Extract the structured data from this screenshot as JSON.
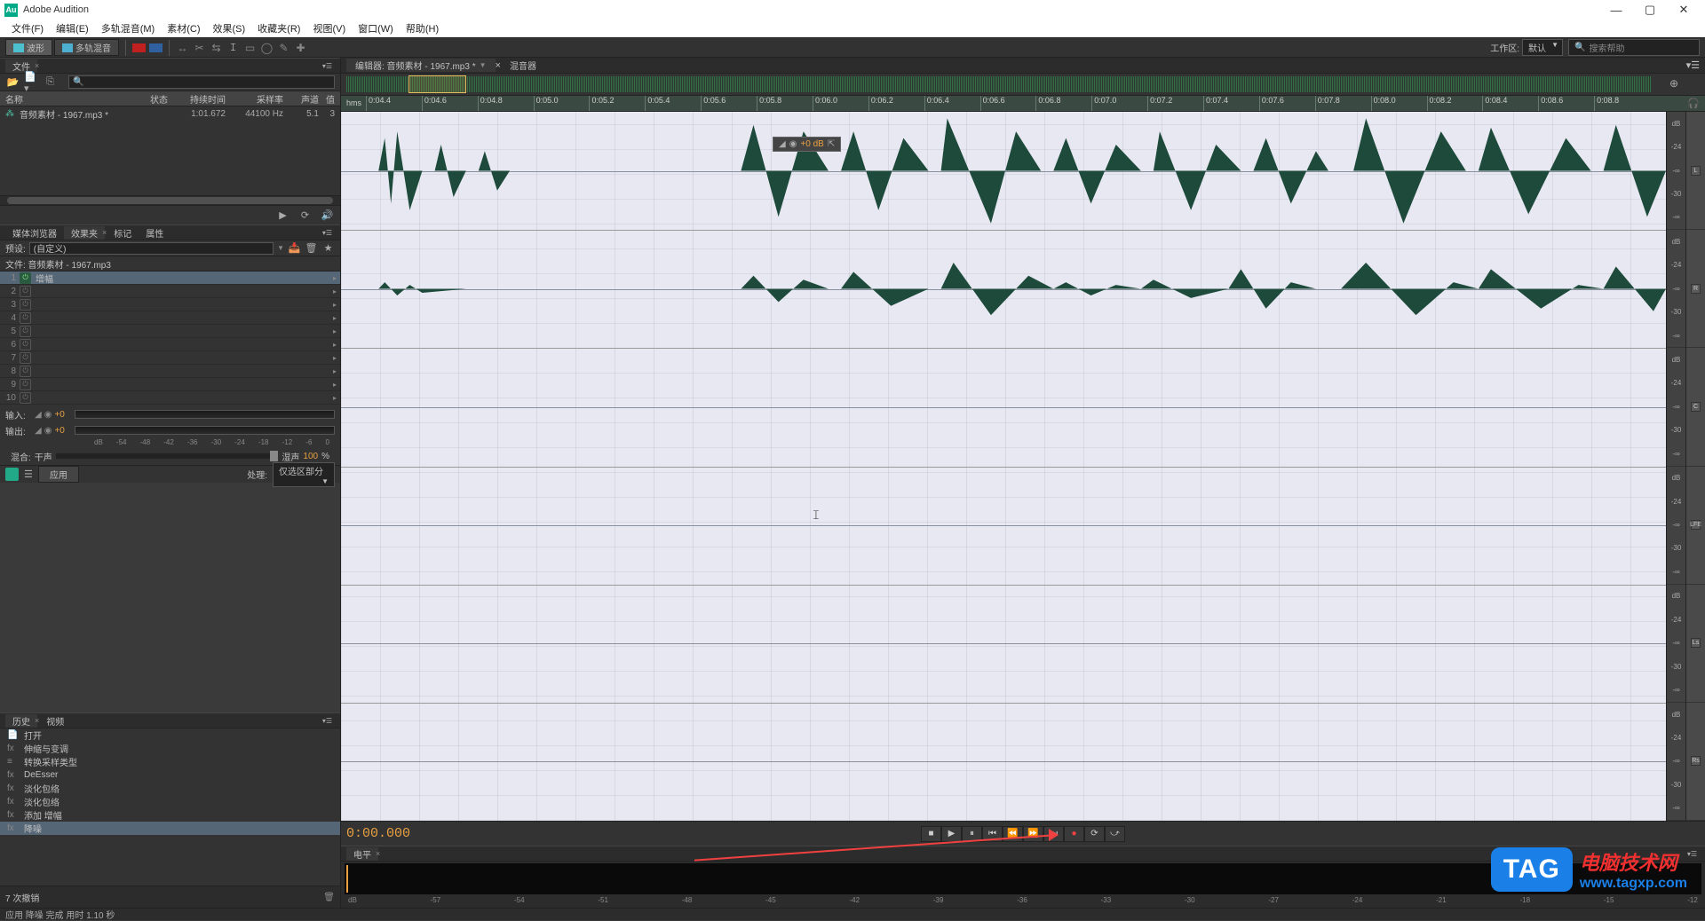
{
  "app": {
    "title": "Adobe Audition"
  },
  "menubar": [
    "文件(F)",
    "编辑(E)",
    "多轨混音(M)",
    "素材(C)",
    "效果(S)",
    "收藏夹(R)",
    "视图(V)",
    "窗口(W)",
    "帮助(H)"
  ],
  "toolbar": {
    "mode_wave": "波形",
    "mode_multi": "多轨混音",
    "workspace_label": "工作区:",
    "workspace_value": "默认",
    "search_placeholder": "搜索帮助"
  },
  "files_panel": {
    "title": "文件",
    "columns": {
      "name": "名称",
      "status": "状态",
      "duration": "持续时间",
      "rate": "采样率",
      "channels": "声道"
    },
    "items": [
      {
        "name": "音频素材 - 1967.mp3 *",
        "duration": "1:01.672",
        "rate": "44100 Hz",
        "channels": "5.1"
      }
    ],
    "ch_extra": "3"
  },
  "tabs_panel": {
    "tabs": [
      "媒体浏览器",
      "效果夹",
      "标记",
      "属性"
    ],
    "active": 1
  },
  "fx_panel": {
    "preset_label": "预设:",
    "preset_value": "(自定义)",
    "file_label": "文件: 音频素材 - 1967.mp3",
    "slots": [
      {
        "n": 1,
        "on": true,
        "name": "增幅"
      },
      {
        "n": 2,
        "on": false,
        "name": ""
      },
      {
        "n": 3,
        "on": false,
        "name": ""
      },
      {
        "n": 4,
        "on": false,
        "name": ""
      },
      {
        "n": 5,
        "on": false,
        "name": ""
      },
      {
        "n": 6,
        "on": false,
        "name": ""
      },
      {
        "n": 7,
        "on": false,
        "name": ""
      },
      {
        "n": 8,
        "on": false,
        "name": ""
      },
      {
        "n": 9,
        "on": false,
        "name": ""
      },
      {
        "n": 10,
        "on": false,
        "name": ""
      }
    ],
    "input_label": "输入:",
    "input_value": "+0",
    "output_label": "输出:",
    "output_value": "+0",
    "db_scale": [
      "dB",
      "-54",
      "-48",
      "-42",
      "-36",
      "-30",
      "-24",
      "-18",
      "-12",
      "-6",
      "0"
    ],
    "mix_label": "混合:",
    "mix_dry": "干声",
    "mix_wet": "湿声",
    "mix_pct": "100",
    "pct_sign": "%",
    "apply": "应用",
    "process_label": "处理:",
    "process_value": "仅选区部分"
  },
  "history_panel": {
    "tabs": [
      "历史",
      "视频"
    ],
    "items": [
      {
        "icon": "📄",
        "label": "打开"
      },
      {
        "icon": "fx",
        "label": "伸缩与变调"
      },
      {
        "icon": "≡",
        "label": "转换采样类型"
      },
      {
        "icon": "fx",
        "label": "DeEsser"
      },
      {
        "icon": "fx",
        "label": "淡化包络"
      },
      {
        "icon": "fx",
        "label": "淡化包络"
      },
      {
        "icon": "fx",
        "label": "添加 增幅"
      },
      {
        "icon": "fx",
        "label": "降噪"
      }
    ],
    "footer": "7 次撤销"
  },
  "editor": {
    "tab_active": "编辑器: 音频素材 - 1967.mp3 *",
    "tab_mixer": "混音器",
    "ruler_unit": "hms",
    "ruler_ticks": [
      "0:04.4",
      "0:04.6",
      "0:04.8",
      "0:05.0",
      "0:05.2",
      "0:05.4",
      "0:05.6",
      "0:05.8",
      "0:06.0",
      "0:06.2",
      "0:06.4",
      "0:06.6",
      "0:06.8",
      "0:07.0",
      "0:07.2",
      "0:07.4",
      "0:07.6",
      "0:07.8",
      "0:08.0",
      "0:08.2",
      "0:08.4",
      "0:08.6",
      "0:08.8"
    ],
    "hud_value": "+0 dB",
    "db_labels": [
      "dB",
      "-24",
      "-∞",
      "-30",
      "-∞"
    ],
    "channels": [
      "L",
      "R",
      "C",
      "LFE",
      "Ls",
      "Rs"
    ]
  },
  "transport": {
    "timecode": "0:00.000"
  },
  "level_panel": {
    "title": "电平",
    "scale": [
      "dB",
      "-57",
      "-54",
      "-51",
      "-48",
      "-45",
      "-42",
      "-39",
      "-36",
      "-33",
      "-30",
      "-27",
      "-24",
      "-21",
      "-18",
      "-15",
      "-12"
    ]
  },
  "statusbar": "应用 降噪 完成 用时 1.10 秒",
  "overlay": {
    "tag": "TAG",
    "zh": "电脑技术网",
    "url": "www.tagxp.com"
  }
}
